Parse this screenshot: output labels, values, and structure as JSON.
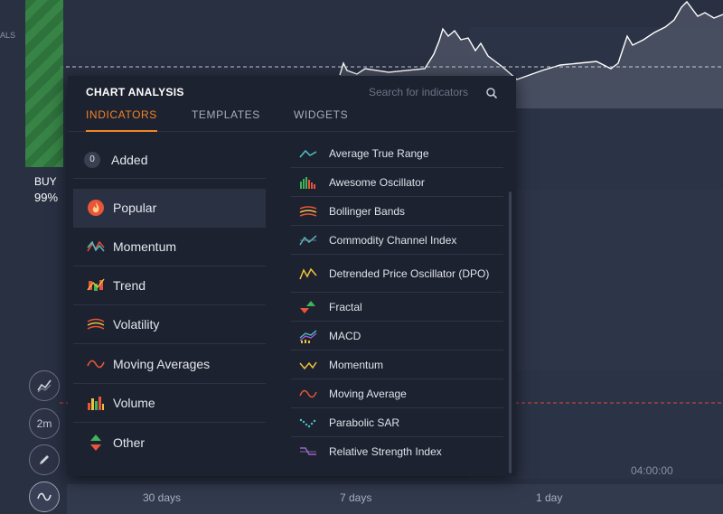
{
  "background": {
    "left_label": "ALS",
    "buy_label": "BUY",
    "buy_percent": "99%",
    "time_label": "04:00:00",
    "timebar": [
      "30 days",
      "7 days",
      "1 day"
    ],
    "tools": [
      {
        "name": "chart-type-icon"
      },
      {
        "label": "2m"
      },
      {
        "name": "pencil-icon"
      },
      {
        "name": "indicators-icon"
      }
    ],
    "colors": {
      "buy": "#3a9347",
      "price_line": "#ffffff",
      "dashed_level": "#e0483c"
    }
  },
  "panel": {
    "title": "CHART ANALYSIS",
    "search_placeholder": "Search for indicators",
    "tabs": [
      {
        "label": "INDICATORS",
        "active": true
      },
      {
        "label": "TEMPLATES",
        "active": false
      },
      {
        "label": "WIDGETS",
        "active": false
      }
    ],
    "added": {
      "count": "0",
      "label": "Added"
    },
    "categories": [
      {
        "label": "Popular",
        "icon": "flame-icon",
        "active": true
      },
      {
        "label": "Momentum",
        "icon": "momentum-icon"
      },
      {
        "label": "Trend",
        "icon": "trend-icon"
      },
      {
        "label": "Volatility",
        "icon": "volatility-icon"
      },
      {
        "label": "Moving Averages",
        "icon": "wave-icon"
      },
      {
        "label": "Volume",
        "icon": "volume-bars-icon"
      },
      {
        "label": "Other",
        "icon": "up-down-arrows-icon"
      }
    ],
    "indicators": [
      {
        "label": "Average True Range",
        "icon": "atr-icon"
      },
      {
        "label": "Awesome Oscillator",
        "icon": "oscillator-bars-icon"
      },
      {
        "label": "Bollinger Bands",
        "icon": "bands-icon"
      },
      {
        "label": "Commodity Channel Index",
        "icon": "cci-icon"
      },
      {
        "label": "Detrended Price Oscillator (DPO)",
        "icon": "dpo-icon"
      },
      {
        "label": "Fractal",
        "icon": "fractal-icon"
      },
      {
        "label": "MACD",
        "icon": "macd-icon"
      },
      {
        "label": "Momentum",
        "icon": "momentum-line-icon"
      },
      {
        "label": "Moving Average",
        "icon": "moving-average-icon"
      },
      {
        "label": "Parabolic SAR",
        "icon": "sar-icon"
      },
      {
        "label": "Relative Strength Index",
        "icon": "rsi-icon"
      }
    ]
  }
}
